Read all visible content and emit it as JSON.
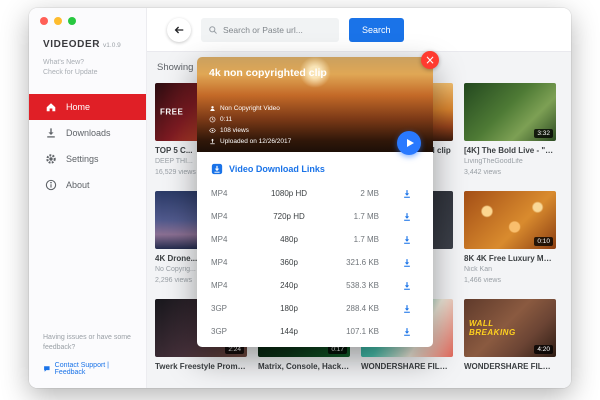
{
  "app": {
    "name": "VIDEODER",
    "version": "v1.0.9",
    "whats_new": "What's New?",
    "check_update": "Check for Update"
  },
  "sidebar": {
    "items": [
      {
        "label": "Home",
        "icon": "home-icon",
        "active": true
      },
      {
        "label": "Downloads",
        "icon": "download-icon",
        "active": false
      },
      {
        "label": "Settings",
        "icon": "gear-icon",
        "active": false
      },
      {
        "label": "About",
        "icon": "info-icon",
        "active": false
      }
    ],
    "feedback_text": "Having issues or have some feedback?",
    "contact_label": "Contact Support | Feedback"
  },
  "topbar": {
    "search_placeholder": "Search or Paste url...",
    "search_button": "Search"
  },
  "main": {
    "showing_label": "Showing",
    "videos": [
      {
        "title": "TOP 5 C...",
        "channel": "DEEP THI...",
        "views": "16,529 views",
        "duration": "",
        "overlay": "FREE"
      },
      {
        "title": "",
        "channel": "",
        "views": "",
        "duration": ""
      },
      {
        "title": "4k non copyrighted clip",
        "channel": "",
        "views": "",
        "duration": ""
      },
      {
        "title": "[4K] The Bold Live - \"Go...",
        "channel": "LivingTheGoodLife",
        "views": "3,442 views",
        "duration": "3:32"
      },
      {
        "title": "4K Drone...",
        "channel": "No Copyrig...",
        "views": "2,296 views",
        "duration": ""
      },
      {
        "title": "",
        "channel": "",
        "views": "",
        "duration": ""
      },
      {
        "title": "",
        "channel": "",
        "views": "",
        "duration": ""
      },
      {
        "title": "8K 4K Free Luxury Motio...",
        "channel": "Nick Kan",
        "views": "1,466 views",
        "duration": "0:10"
      },
      {
        "title": "Twerk Freestyle Promo V...",
        "duration": "2:24"
      },
      {
        "title": "Matrix, Console, Hacking...",
        "duration": "0:17"
      },
      {
        "title": "WONDERSHARE FILMO...",
        "duration": ""
      },
      {
        "title": "WONDERSHARE FILMO...",
        "duration": "4:20",
        "overlay": "WALL BREAKING"
      }
    ]
  },
  "modal": {
    "title": "4k non copyrighted clip",
    "meta": [
      {
        "icon": "person-icon",
        "text": "Non Copyright Video"
      },
      {
        "icon": "clock-icon",
        "text": "0:11"
      },
      {
        "icon": "eye-icon",
        "text": "108 views"
      },
      {
        "icon": "upload-icon",
        "text": "Uploaded on 12/26/2017"
      }
    ],
    "links_title": "Video Download Links",
    "downloads": [
      {
        "format": "MP4",
        "quality": "1080p HD",
        "size": "2 MB"
      },
      {
        "format": "MP4",
        "quality": "720p HD",
        "size": "1.7 MB"
      },
      {
        "format": "MP4",
        "quality": "480p",
        "size": "1.7 MB"
      },
      {
        "format": "MP4",
        "quality": "360p",
        "size": "321.6 KB"
      },
      {
        "format": "MP4",
        "quality": "240p",
        "size": "538.3 KB"
      },
      {
        "format": "3GP",
        "quality": "180p",
        "size": "288.4 KB"
      },
      {
        "format": "3GP",
        "quality": "144p",
        "size": "107.1 KB"
      }
    ]
  },
  "colors": {
    "accent_red": "#e01f26",
    "accent_blue": "#1a73e8",
    "play_blue": "#2979ff",
    "close_red": "#ff3b30"
  }
}
